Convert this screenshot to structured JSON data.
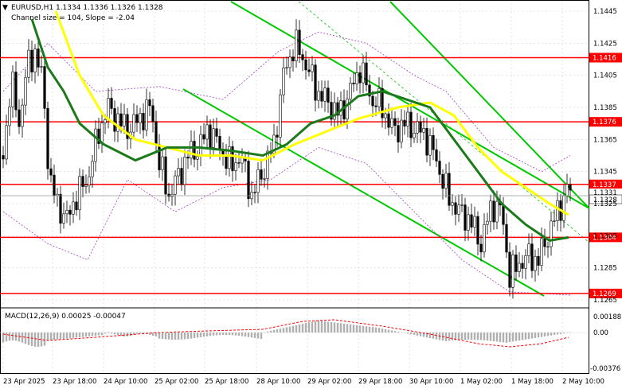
{
  "header": {
    "symbol_line": "EURUSD,H1  1.1334 1.1336 1.1326 1.1328",
    "channel_line": "Channel size = 104, Slope = -2.04"
  },
  "macd": {
    "label": "MACD(12,26,9) 0.00025 -0.00047",
    "ticks": [
      "0.00188",
      "0.00",
      "-0.00376"
    ]
  },
  "price_axis": {
    "ticks": [
      "1.1445",
      "1.1425",
      "1.1405",
      "1.1385",
      "1.1365",
      "1.1345",
      "1.1325",
      "1.1305",
      "1.1285",
      "1.1265"
    ],
    "current_price": "1.1328",
    "secondary_price": "1.1331"
  },
  "levels": [
    {
      "price": 1.1416,
      "label": "1.1416"
    },
    {
      "price": 1.1376,
      "label": "1.1376"
    },
    {
      "price": 1.1337,
      "label": "1.1337"
    },
    {
      "price": 1.1304,
      "label": "1.1304"
    },
    {
      "price": 1.1269,
      "label": "1.1269"
    }
  ],
  "time_axis": [
    "23 Apr 2025",
    "23 Apr 18:00",
    "24 Apr 10:00",
    "25 Apr 02:00",
    "25 Apr 18:00",
    "28 Apr 10:00",
    "29 Apr 02:00",
    "29 Apr 18:00",
    "30 Apr 10:00",
    "1 May 02:00",
    "1 May 18:00",
    "2 May 10:00"
  ],
  "colors": {
    "level_line": "#ff0000",
    "level_label_bg": "#ff0000",
    "ma_fast": "#ffff00",
    "ma_slow": "#1a7a1a",
    "channel": "#00c800",
    "candle": "#000000",
    "macd_hist": "#b0b0b0",
    "macd_signal": "#ff0000",
    "grid": "#c0c0c0"
  }
}
